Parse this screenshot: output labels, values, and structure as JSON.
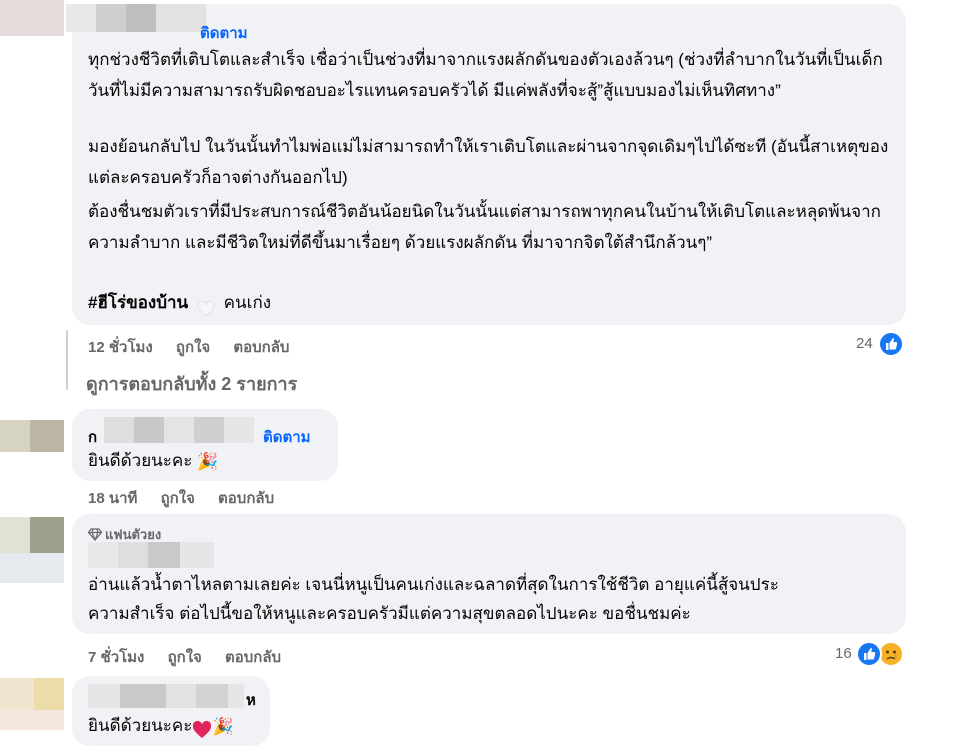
{
  "comment1": {
    "follow": "ติดตาม",
    "paragraphs": [
      "ทุกช่วงชีวิตที่เติบโตและสำเร็จ เชื่อว่าเป็นช่วงที่มาจากแรงผลักดันของตัวเองล้วนๆ (ช่วงที่ลำบากในวันที่เป็นเด็ก วันที่ไม่มีความสามารถรับผิดชอบอะไรแทนครอบครัวได้ มีแค่พลังที่จะสู้”สู้แบบมองไม่เห็นทิศทาง”",
      "มองย้อนกลับไป ในวันนั้นทำไมพ่อแม่ไม่สามารถทำให้เราเติบโตและผ่านจากจุดเดิมๆไปได้ซะที (อันนี้สาเหตุของแต่ละครอบครัวก็อาจต่างกันออกไป)",
      "ต้องชื่นชมตัวเราที่มีประสบการณ์ชีวิตอันน้อยนิดในวันนั้นแต่สามารถพาทุกคนในบ้านให้เติบโตและหลุดพ้นจากความลำบาก และมีชีวิตใหม่ที่ดีขึ้นมาเรื่อยๆ ด้วยแรงผลักดัน ที่มาจากจิตใต้สำนึกล้วนๆ”"
    ],
    "hashtag": "#ฮีโร่ของบ้าน",
    "hashtag_suffix": "คนเก่ง",
    "time": "12 ชั่วโมง",
    "like": "ถูกใจ",
    "reply": "ตอบกลับ",
    "reactions": "24"
  },
  "view_replies": "ดูการตอบกลับทั้ง 2 รายการ",
  "reply1": {
    "name_prefix": "ก",
    "follow": "ติดตาม",
    "text": "ยินดีด้วยนะคะ",
    "time": "18 นาที",
    "like": "ถูกใจ",
    "reply": "ตอบกลับ"
  },
  "comment2": {
    "badge": "แฟนตัวยง",
    "text_line1": "อ่านแล้วน้ำตาไหลตามเลยค่ะ เจนนี่หนูเป็นคนเก่งและฉลาดที่สุดในการใช้ชีวิต อายุแค่นี้สู้จนประ",
    "text_line2": "ความสำเร็จ ต่อไปนี้ขอให้หนูและครอบครัวมีแต่ความสุขตลอดไปนะคะ ขอชื่นชมค่ะ",
    "time": "7 ชั่วโมง",
    "like": "ถูกใจ",
    "reply": "ตอบกลับ",
    "reactions": "16"
  },
  "reply2": {
    "name_suffix": "ห",
    "text": "ยินดีด้วยนะคะ"
  },
  "colors": {
    "link": "#0866ff",
    "bubble": "#f0f2f5",
    "meta": "#65676b",
    "like": "#1877f2"
  }
}
